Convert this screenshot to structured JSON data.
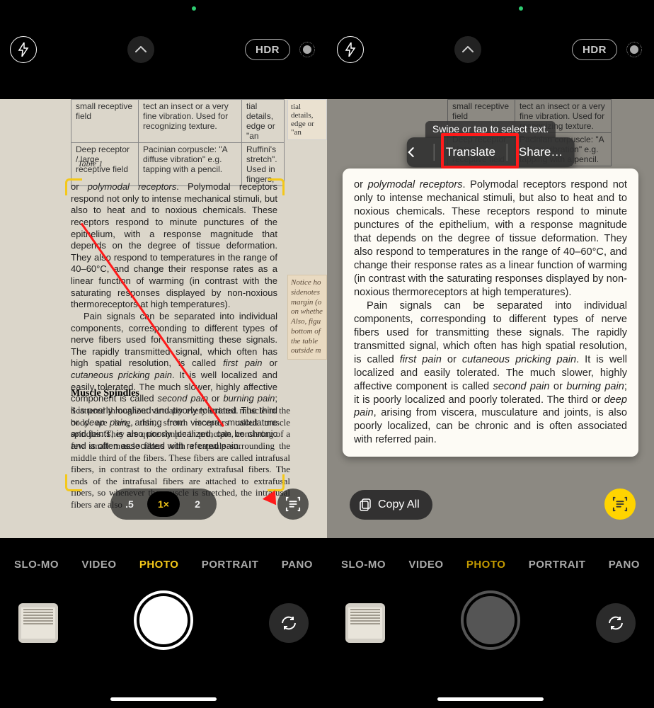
{
  "topbar": {
    "hdr": "HDR"
  },
  "hint": "Swipe or tap to select text.",
  "actionbar": {
    "translate": "Translate",
    "share": "Share…"
  },
  "copyall": "Copy All",
  "zoom": {
    "z05": ".5",
    "z1": "1×",
    "z2": "2"
  },
  "modes": {
    "slomo": "SLO-MO",
    "video": "VIDEO",
    "photo": "PHOTO",
    "portrait": "PORTRAIT",
    "pano": "PANO"
  },
  "page": {
    "rows": [
      {
        "c1": "small receptive field",
        "c2": "tect an insect or a very fine vibration. Used for recognizing texture.",
        "c3": "tial details, edge or \"an"
      },
      {
        "c1": "Deep receptor / large receptive field",
        "c2": "Pacinian corpuscle: \"A diffuse vibration\" e.g. tapping with a pencil.",
        "c3": "Ruffini's stretch\". Used in fingers,"
      }
    ],
    "caption": "Table 1",
    "side": "Notice ho sidenotes margin (o on whethe Also, figu bottom of the table outside m",
    "h4": "Muscle Spindles",
    "body2": "Scattered throughout virtually every striated muscle in the body are long, thin, stretch receptors called muscle spindles. They are quite simple in principle, consisting of a few small muscle fibers with a capsule surrounding the middle third of the fibers. These fibers are called intrafusal fibers, in contrast to the ordinary extrafusal fibers. The ends of the intrafusal fibers are attached to extrafusal fibers, so whenever the muscle is stretched, the intrafusal fibers are also"
  },
  "text": {
    "p1a": "or ",
    "p1b": "polymodal receptors",
    "p1c": ". Polymodal receptors respond not only to intense mechanical stimuli, but also to heat and to noxious chemicals. These receptors respond to minute punctures of the epithelium, with a response magnitude that depends on the degree of tissue deformation. They also respond to temperatures in the range of 40–60°C, and change their response rates as a linear function of warming (in contrast with the saturating responses displayed by non-noxious thermoreceptors at high temperatures).",
    "p2a": "Pain signals can be separated into individual components, corresponding to different types of nerve fibers used for transmitting these signals. The rapidly transmitted signal, which often has high spatial resolution, is called ",
    "p2b": "first pain",
    "p2c": " or ",
    "p2d": "cutaneous pricking pain",
    "p2e": ". It is well localized and easily tolerated. The much slower, highly affective component is called ",
    "p2f": "second pain",
    "p2g": " or ",
    "p2h": "burning pain",
    "p2i": "; it is poorly localized and poorly tolerated. The third or ",
    "p2j": "deep pain",
    "p2k": ", arising from viscera, musculature and joints, is also poorly localized, can be chronic and is often associated with referred pain."
  }
}
